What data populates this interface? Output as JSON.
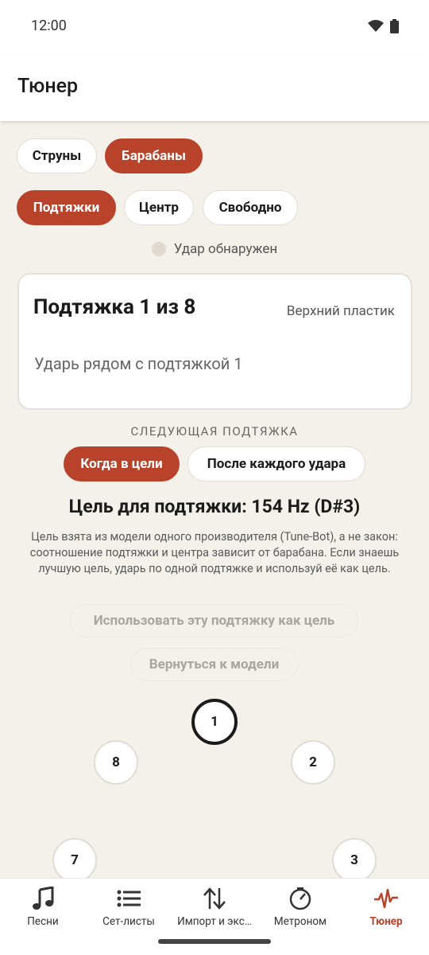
{
  "status_bar": {
    "time": "12:00"
  },
  "app_bar": {
    "title": "Тюнер"
  },
  "instrument_tabs": [
    {
      "label": "Струны",
      "active": false
    },
    {
      "label": "Барабаны",
      "active": true
    }
  ],
  "mode_tabs": [
    {
      "label": "Подтяжки",
      "active": true
    },
    {
      "label": "Центр",
      "active": false
    },
    {
      "label": "Свободно",
      "active": false
    }
  ],
  "hit_indicator": {
    "label": "Удар обнаружен"
  },
  "lug_card": {
    "title": "Подтяжка 1 из 8",
    "head": "Верхний пластик",
    "hint": "Ударь рядом с подтяжкой 1"
  },
  "next_lug": {
    "section_label": "СЛЕДУЮЩАЯ ПОДТЯЖКА",
    "options": [
      {
        "label": "Когда в цели",
        "active": true
      },
      {
        "label": "После каждого удара",
        "active": false
      }
    ]
  },
  "target": {
    "line": "Цель для подтяжки: 154 Hz (D#3)",
    "description": "Цель взята из модели одного производителя (Tune-Bot), а не закон: соотношение подтяжки и центра зависит от барабана. Если знаешь лучшую цель, ударь по одной подтяжке и используй её как цель."
  },
  "actions": {
    "use_lug_as_target": "Использовать эту подтяжку как цель",
    "back_to_model": "Вернуться к модели"
  },
  "lugs": [
    "1",
    "2",
    "3",
    "7",
    "8"
  ],
  "current_lug": "1",
  "bottom_nav": [
    {
      "label": "Песни",
      "icon": "music-note-icon",
      "active": false
    },
    {
      "label": "Сет-листы",
      "icon": "list-icon",
      "active": false
    },
    {
      "label": "Импорт и экс…",
      "icon": "import-export-icon",
      "active": false
    },
    {
      "label": "Метроном",
      "icon": "metronome-icon",
      "active": false
    },
    {
      "label": "Тюнер",
      "icon": "tuner-waveform-icon",
      "active": true
    }
  ],
  "colors": {
    "accent": "#b9432a",
    "background": "#f4f1ea",
    "surface": "#ffffff",
    "text": "#1c1b1b"
  }
}
